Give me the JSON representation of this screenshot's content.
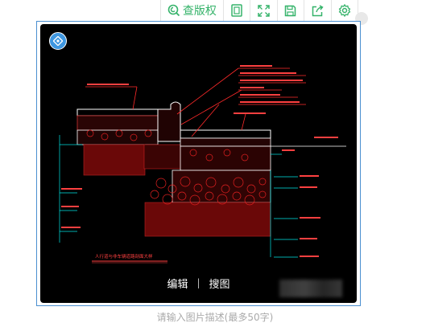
{
  "toolbar": {
    "check_copyright_label": "查版权",
    "icons": [
      "check-copyright-icon",
      "fit-frame-icon",
      "fullscreen-icon",
      "save-icon",
      "share-icon",
      "settings-icon"
    ],
    "accent": "#35b36a"
  },
  "image_overlay": {
    "edit_label": "编辑",
    "separator": "|",
    "search_label": "搜图"
  },
  "drawing": {
    "title": "人行道与非车辆道路剖面大样",
    "palette": {
      "background": "#000000",
      "lines": "#ffffff",
      "annotations": "#ff2a2a",
      "leaders": "#00e5e5"
    }
  },
  "caption": {
    "placeholder": "请输入图片描述(最多50字)"
  }
}
